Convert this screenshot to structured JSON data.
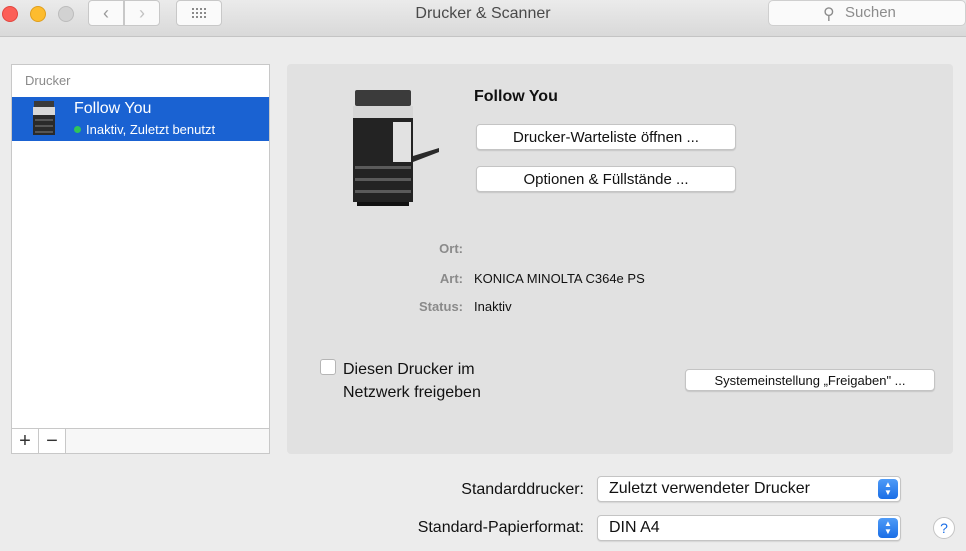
{
  "window": {
    "title": "Drucker & Scanner",
    "search_placeholder": "Suchen",
    "nav_back_icon": "‹",
    "nav_forward_icon": "›",
    "grid_icon": "⋮⋮⋮"
  },
  "sidebar": {
    "header": "Drucker",
    "items": [
      {
        "name": "Follow You",
        "status": "Inaktiv, Zuletzt benutzt",
        "status_color": "#30c45a"
      }
    ],
    "add_label": "+",
    "remove_label": "−"
  },
  "detail": {
    "printer_name": "Follow You",
    "queue_button": "Drucker-Warteliste öffnen ...",
    "options_button": "Optionen & Füllstände ...",
    "ort_label": "Ort:",
    "ort_value": "",
    "art_label": "Art:",
    "art_value": "KONICA MINOLTA C364e PS",
    "status_label": "Status:",
    "status_value": "Inaktiv",
    "share_label": "Diesen Drucker im Netzwerk freigeben",
    "share_checked": false,
    "sharing_prefs_button": "Systemeinstellung „Freigaben\" ..."
  },
  "defaults": {
    "default_printer_label": "Standarddrucker:",
    "default_printer_value": "Zuletzt verwendeter Drucker",
    "paper_label": "Standard-Papierformat:",
    "paper_value": "DIN A4"
  },
  "help_label": "?",
  "colors": {
    "accent": "#1a62d2",
    "selection_text": "#ffffff"
  }
}
